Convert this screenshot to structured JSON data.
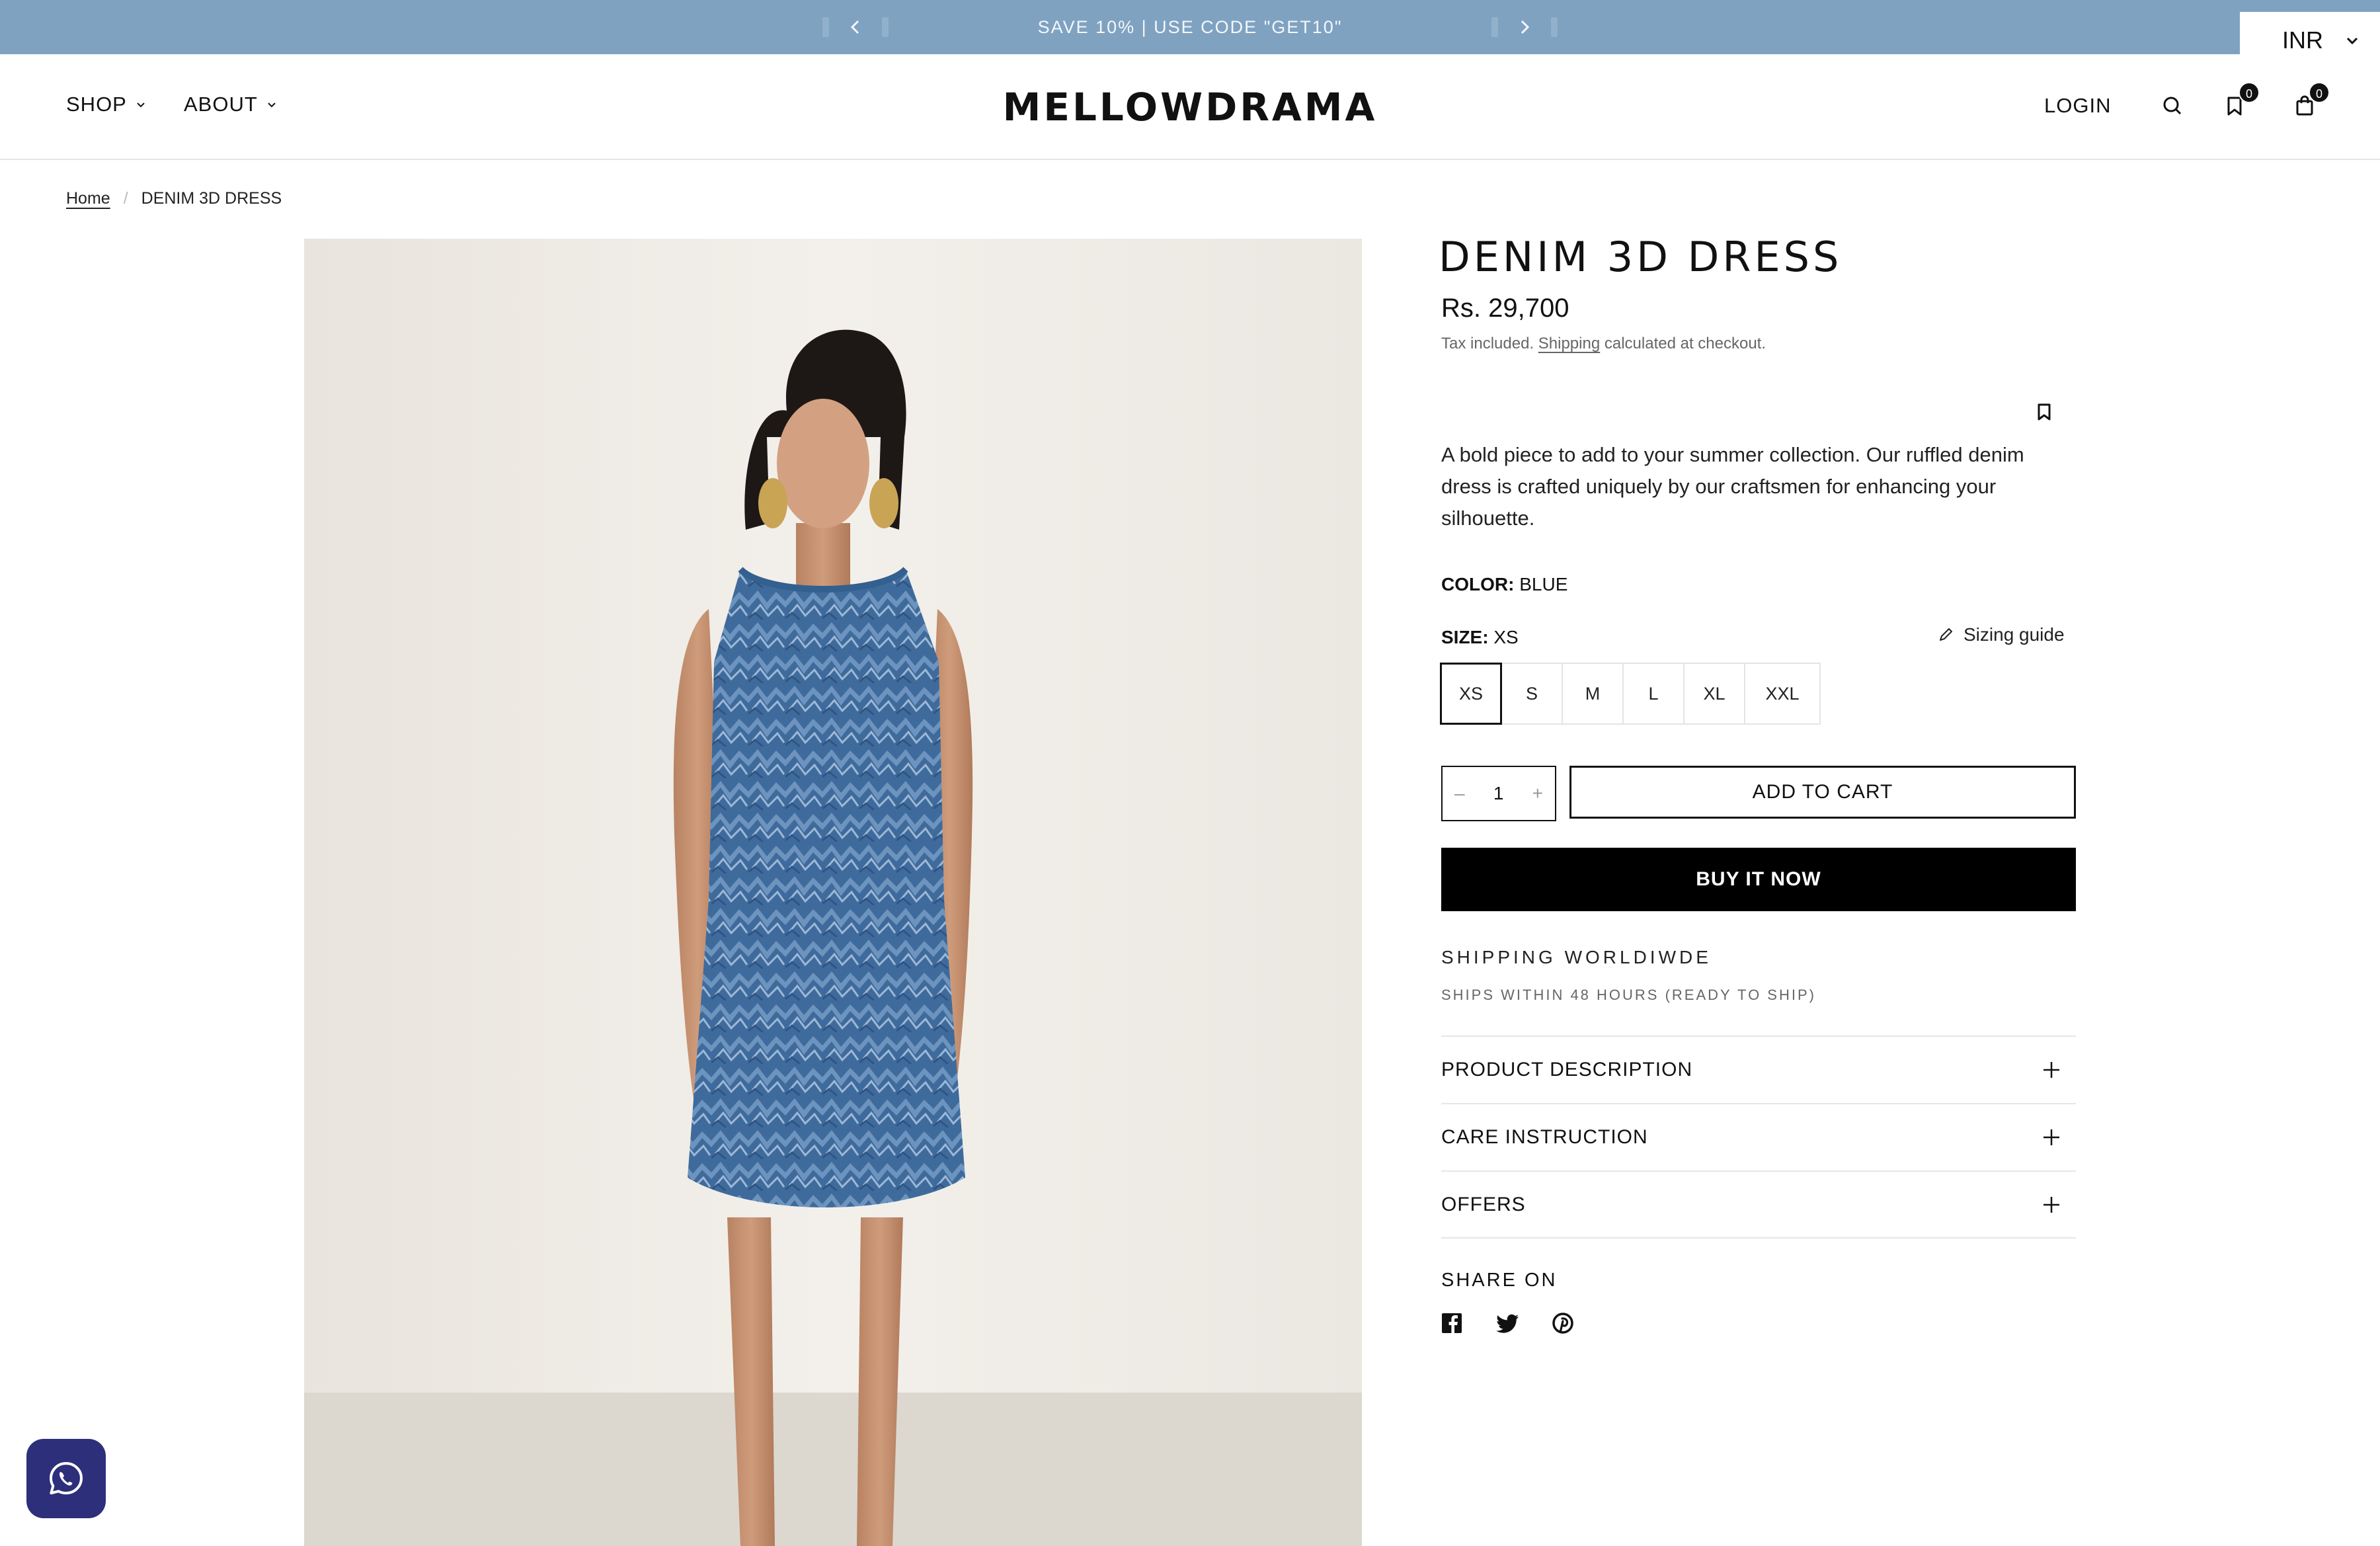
{
  "announcement": {
    "text": "SAVE 10% | USE CODE \"GET10\""
  },
  "currency": {
    "selected": "INR"
  },
  "header": {
    "nav": [
      {
        "label": "SHOP"
      },
      {
        "label": "ABOUT"
      }
    ],
    "logo": "MELLOWDRAMA",
    "login": "LOGIN",
    "wishlist_count": "0",
    "cart_count": "0"
  },
  "breadcrumb": {
    "home": "Home",
    "current": "DENIM 3D DRESS"
  },
  "product": {
    "title": "DENIM 3D DRESS",
    "price": "Rs. 29,700",
    "tax_prefix": "Tax included.",
    "tax_link": "Shipping",
    "tax_suffix": "calculated at checkout.",
    "description": "A bold piece to add to your summer collection. Our ruffled denim dress is crafted uniquely by our craftsmen for enhancing your silhouette.",
    "color_label": "COLOR:",
    "color_value": "BLUE",
    "size_label": "SIZE:",
    "size_value": "XS",
    "sizing_guide": "Sizing guide",
    "sizes": [
      "XS",
      "S",
      "M",
      "L",
      "XL",
      "XXL"
    ],
    "selected_size": "XS",
    "quantity": "1",
    "add_to_cart": "ADD TO CART",
    "buy_now": "BUY IT NOW",
    "shipping_title": "SHIPPING WORLDIWDE",
    "shipping_sub": "SHIPS WITHIN 48 HOURS (READY TO SHIP)",
    "accordions": [
      {
        "label": "PRODUCT DESCRIPTION"
      },
      {
        "label": "CARE INSTRUCTION"
      },
      {
        "label": "OFFERS"
      }
    ],
    "share_title": "SHARE ON"
  },
  "colors": {
    "announcement_bg": "#7fa2c1",
    "whatsapp_bg": "#2d2f7b",
    "denim": "#4a76a8"
  }
}
